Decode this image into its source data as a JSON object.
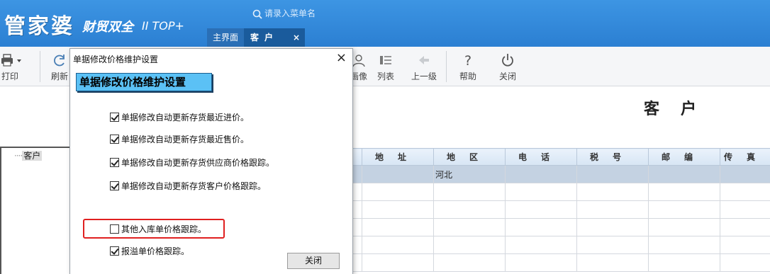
{
  "header": {
    "logo_text": "管家婆",
    "logo_sub": "财贸双全",
    "logo_version": "II TOP+",
    "search_placeholder": "请录入菜单名",
    "tabs": [
      {
        "label": "主界面"
      },
      {
        "label": "客户",
        "close": "×"
      }
    ]
  },
  "toolbar": {
    "items": [
      {
        "label": "打印",
        "icon": "printer-icon"
      },
      {
        "label": "刷新",
        "icon": "refresh-icon"
      },
      {
        "label": "画像",
        "icon": "portrait-icon"
      },
      {
        "label": "列表",
        "icon": "list-icon"
      },
      {
        "label": "上一级",
        "icon": "arrow-left-icon"
      },
      {
        "label": "帮助",
        "icon": "help-icon"
      },
      {
        "label": "关闭",
        "icon": "power-icon"
      }
    ]
  },
  "page": {
    "title": "客户"
  },
  "tree": {
    "root_label": "客户"
  },
  "grid": {
    "columns": [
      "地址",
      "地区",
      "电话",
      "税号",
      "邮编",
      "传真"
    ],
    "rows": [
      [
        "",
        "河北",
        "",
        "",
        "",
        ""
      ],
      [
        "",
        "",
        "",
        "",
        "",
        ""
      ],
      [
        "",
        "",
        "",
        "",
        "",
        ""
      ],
      [
        "",
        "",
        "",
        "",
        "",
        ""
      ],
      [
        "",
        "",
        "",
        "",
        "",
        ""
      ],
      [
        "",
        "",
        "",
        "",
        "",
        ""
      ]
    ]
  },
  "dialog": {
    "title": "单据修改价格维护设置",
    "banner": "单据修改价格维护设置",
    "close_glyph": "×",
    "options": [
      {
        "label": "单据修改自动更新存货最近进价。",
        "checked": true
      },
      {
        "label": "单据修改自动更新存货最近售价。",
        "checked": true
      },
      {
        "label": "单据修改自动更新存货供应商价格跟踪。",
        "checked": true
      },
      {
        "label": "单据修改自动更新存货客户价格跟踪。",
        "checked": true
      },
      {
        "label": "其他入库单价格跟踪。",
        "checked": false
      },
      {
        "label": "报溢单价格跟踪。",
        "checked": true
      }
    ],
    "close_button": "关闭",
    "highlight_color": "#e02020"
  },
  "colors": {
    "header_blue": "#2b7fd2",
    "active_tab": "#1a5b9c",
    "banner_cyan": "#5bc1f5",
    "selected_row": "#c4d2e2"
  }
}
